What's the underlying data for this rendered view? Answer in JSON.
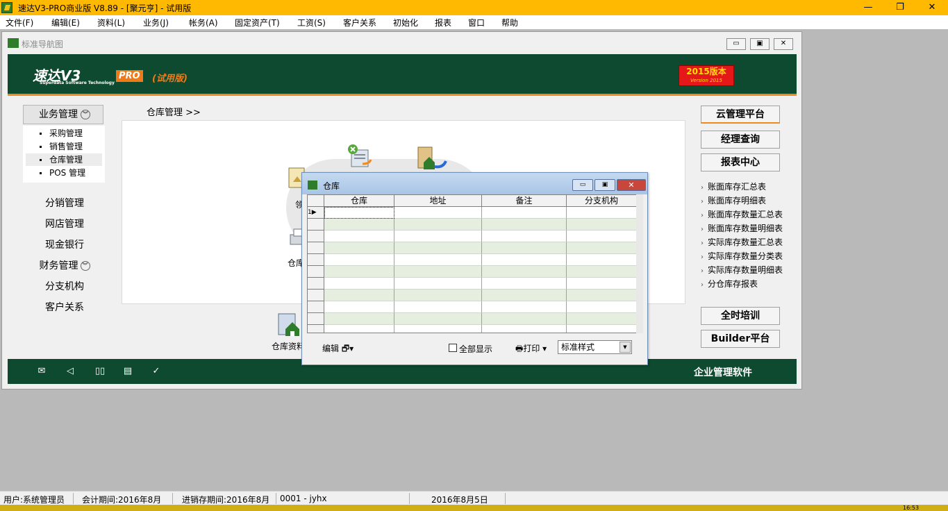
{
  "window": {
    "title": "速达V3-PRO商业版 V8.89 - [聚元亨] - 试用版",
    "minimize": "—",
    "restore": "❐",
    "close": "✕"
  },
  "menu": [
    "文件(F)",
    "编辑(E)",
    "资料(L)",
    "业务(J)",
    "帐务(A)",
    "固定资产(T)",
    "工资(S)",
    "客户关系",
    "初始化",
    "报表",
    "窗口",
    "帮助"
  ],
  "nav_window": {
    "title": "标准导航图",
    "logo": "速达V3",
    "logo_sub": "Superdata Software Technology",
    "pro": "PRO",
    "trial": "(试用版)",
    "badge_main": "2015版本",
    "badge_sub": "Version 2015"
  },
  "left_nav": {
    "header": "业务管理",
    "sub_items": [
      "采购管理",
      "销售管理",
      "仓库管理",
      "POS 管理"
    ],
    "items": [
      "分销管理",
      "网店管理",
      "现金银行",
      "财务管理",
      "分支机构",
      "客户关系"
    ]
  },
  "breadcrumb": "仓库管理 >>",
  "flow": {
    "label_left_top": "领",
    "label_left_bottom": "仓库",
    "label_bottom": "仓库资料"
  },
  "right_panel": {
    "buttons": [
      "云管理平台",
      "经理查询",
      "报表中心"
    ],
    "links": [
      "账面库存汇总表",
      "账面库存明细表",
      "账面库存数量汇总表",
      "账面库存数量明细表",
      "实际库存数量汇总表",
      "实际库存数量分类表",
      "实际库存数量明细表",
      "分仓库存报表"
    ],
    "bottom_buttons": [
      "全时培训",
      "Builder平台"
    ]
  },
  "footer": {
    "text": "企业管理软件"
  },
  "dialog": {
    "title": "仓库",
    "columns": [
      "仓库",
      "地址",
      "备注",
      "分支机构"
    ],
    "first_row_index": "1",
    "edit_label": "编辑",
    "show_all_label": "全部显示",
    "print_label": "打印",
    "style_value": "标准样式"
  },
  "status": {
    "user": "用户:系统管理员",
    "account_period": "会计期间:2016年8月",
    "inventory_period": "进销存期间:2016年8月",
    "company": "0001 - jyhx",
    "date": "2016年8月5日",
    "clock": "16:53"
  }
}
